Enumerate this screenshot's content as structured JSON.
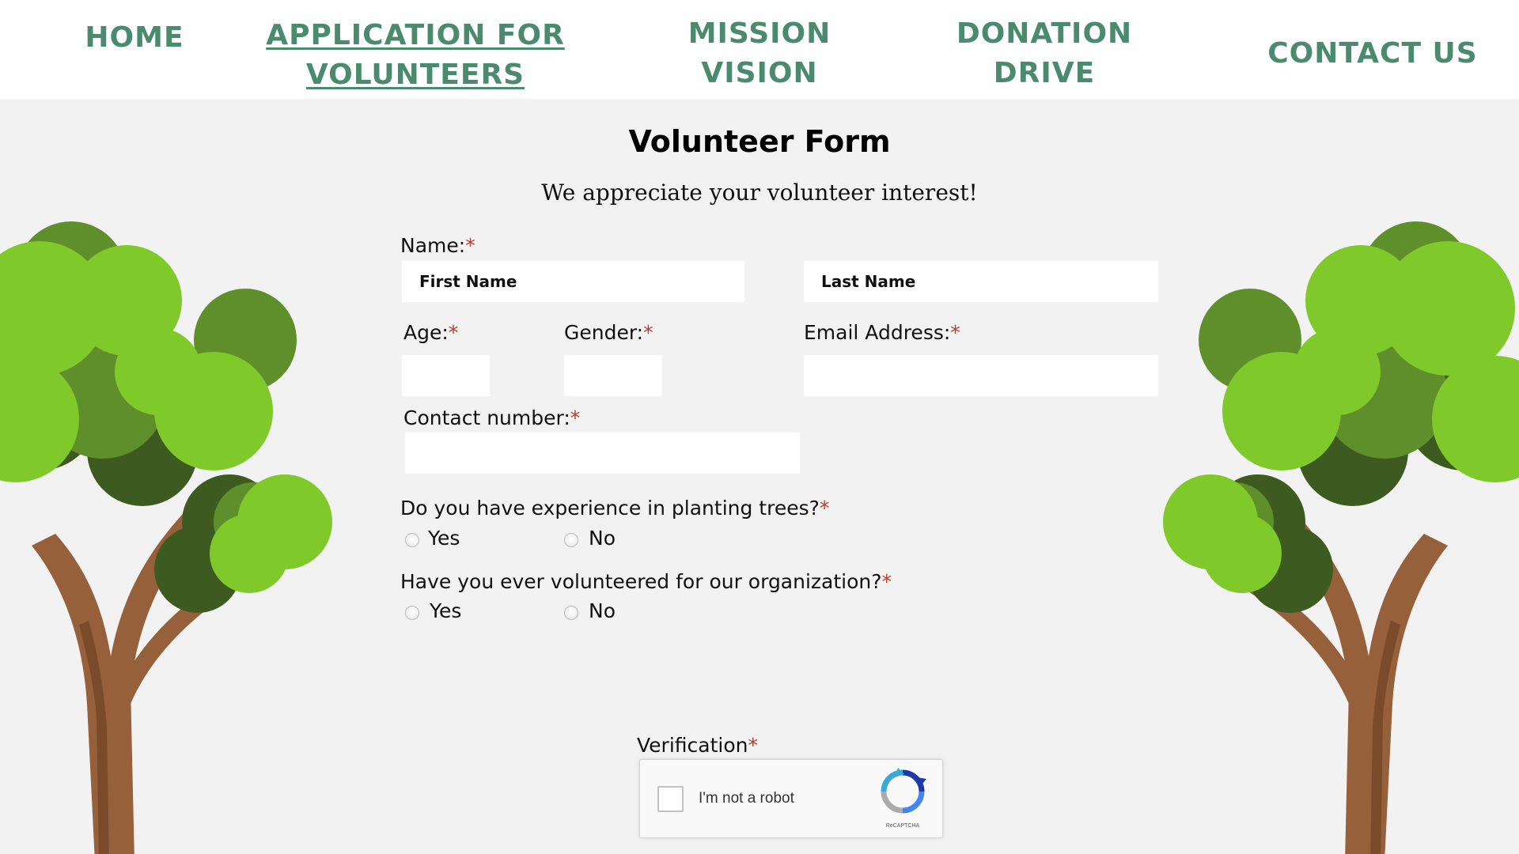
{
  "nav": {
    "home": "HOME",
    "application_line1": "APPLICATION FOR",
    "application_line2": "VOLUNTEERS",
    "mission_line1": "MISSION",
    "mission_line2": "VISION",
    "donation_line1": "DONATION",
    "donation_line2": "DRIVE",
    "contact": "CONTACT US",
    "active": "application",
    "color": "#4a8a6d"
  },
  "form": {
    "title": "Volunteer Form",
    "subtitle": "We appreciate your volunteer interest!",
    "required_mark": "*",
    "name_label": "Name:",
    "first_name_placeholder": "First Name",
    "last_name_placeholder": "Last Name",
    "age_label": "Age:",
    "gender_label": "Gender:",
    "email_label": "Email Address:",
    "contact_label": "Contact number:",
    "q1": "Do you have experience in planting trees?",
    "q2": "Have you ever volunteered for our organization?",
    "yes": "Yes",
    "no": "No",
    "verification_label": "Verification"
  },
  "captcha": {
    "text": "I'm not a robot",
    "brand": "ReCAPTCHA"
  },
  "icons": {
    "trees": "tree-illustration",
    "captcha_logo": "recaptcha-icon"
  }
}
